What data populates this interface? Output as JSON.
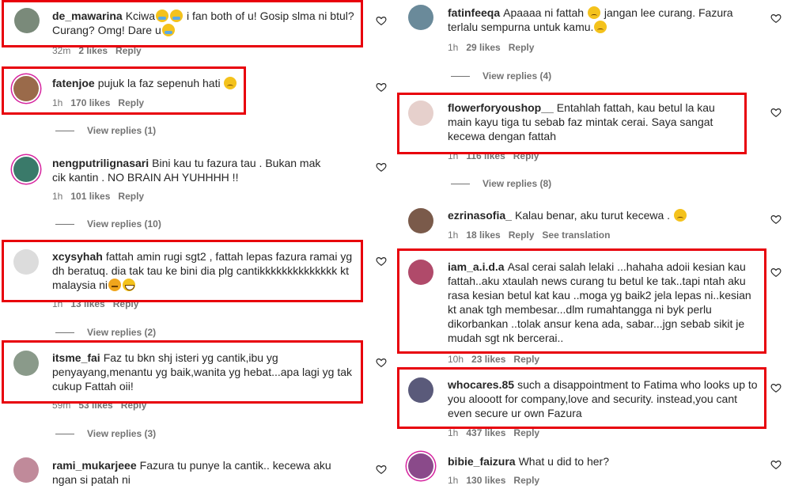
{
  "left": [
    {
      "username": "de_mawarina",
      "text": "Kciwa",
      "text2": "i fan both of u! Gosip slma ni btul? Curang? Omg! Dare u",
      "time": "32m",
      "likes": "2 likes",
      "reply": "Reply"
    },
    {
      "username": "fatenjoe",
      "text": "pujuk la faz sepenuh hati",
      "time": "1h",
      "likes": "170 likes",
      "reply": "Reply",
      "view_replies": "View replies (1)"
    },
    {
      "username": "nengputrilignasari",
      "text": "Bini kau tu fazura tau . Bukan mak cik kantin . NO BRAIN AH YUHHHH !!",
      "time": "1h",
      "likes": "101 likes",
      "reply": "Reply",
      "view_replies": "View replies (10)"
    },
    {
      "username": "xcysyhah",
      "text": "fattah amin rugi sgt2 , fattah lepas fazura ramai yg dh beratuq. dia tak tau ke bini dia plg cantikkkkkkkkkkkkkk kt malaysia ni",
      "time": "1h",
      "likes": "13 likes",
      "reply": "Reply",
      "view_replies": "View replies (2)"
    },
    {
      "username": "itsme_fai",
      "text": "Faz tu bkn shj isteri yg cantik,ibu yg penyayang,menantu yg baik,wanita yg hebat...apa lagi yg tak cukup Fattah oii!",
      "time": "59m",
      "likes": "53 likes",
      "reply": "Reply",
      "view_replies": "View replies (3)"
    },
    {
      "username": "rami_mukarjeee",
      "text": "Fazura tu punye la cantik.. kecewa aku ngan si patah ni"
    }
  ],
  "right": [
    {
      "username": "fatinfeeqa",
      "text": "Apaaaa ni fattah",
      "text2": "jangan lee curang. Fazura terlalu sempurna untuk kamu.",
      "time": "1h",
      "likes": "29 likes",
      "reply": "Reply",
      "view_replies": "View replies (4)"
    },
    {
      "username": "flowerforyoushop__",
      "text": "Entahlah fattah, kau betul la kau main kayu tiga tu sebab faz mintak cerai. Saya sangat kecewa dengan fattah",
      "time": "1h",
      "likes": "116 likes",
      "reply": "Reply",
      "view_replies": "View replies (8)"
    },
    {
      "username": "ezrinasofia_",
      "text": "Kalau benar, aku turut kecewa .",
      "time": "1h",
      "likes": "18 likes",
      "reply": "Reply",
      "translate": "See translation"
    },
    {
      "username": "iam_a.i.d.a",
      "text": "Asal cerai salah lelaki ...hahaha adoii kesian kau fattah..aku xtaulah news curang tu betul ke tak..tapi ntah aku rasa kesian betul kat kau ..moga yg baik2 jela lepas ni..kesian kt anak tgh membesar...dlm rumahtangga ni byk perlu dikorbankan ..tolak ansur kena ada, sabar...jgn sebab sikit je mudah sgt nk bercerai..",
      "time": "10h",
      "likes": "23 likes",
      "reply": "Reply"
    },
    {
      "username": "whocares.85",
      "text": "such a disappointment to Fatima who looks up to you alooott for company,love and security. instead,you cant even secure ur own Fazura",
      "time": "1h",
      "likes": "437 likes",
      "reply": "Reply"
    },
    {
      "username": "bibie_faizura",
      "text": "What u did to her?",
      "time": "1h",
      "likes": "130 likes",
      "reply": "Reply"
    }
  ],
  "colors": {
    "highlight": "#e8000b",
    "text": "#262626",
    "muted": "#737373"
  }
}
